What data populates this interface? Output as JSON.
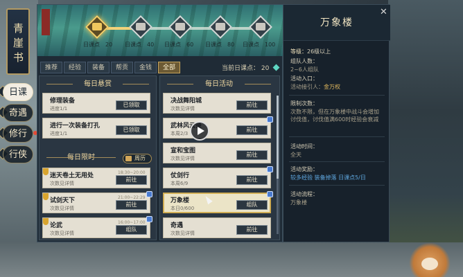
{
  "sidebar": {
    "book_title": "青崖书",
    "tabs": [
      {
        "label": "日课",
        "active": true
      },
      {
        "label": "奇遇",
        "active": false
      },
      {
        "label": "修行",
        "active": false,
        "red_dot": true
      },
      {
        "label": "行侠",
        "active": false
      }
    ]
  },
  "banner": {
    "progress": 0.2,
    "milestones": [
      {
        "label": "日课点",
        "value": "20"
      },
      {
        "label": "日课点",
        "value": "40"
      },
      {
        "label": "日课点",
        "value": "60"
      },
      {
        "label": "日课点",
        "value": "80"
      },
      {
        "label": "日课点",
        "value": "100"
      }
    ]
  },
  "tabs": [
    "推荐",
    "经验",
    "装备",
    "帮贡",
    "金钱",
    "全部"
  ],
  "active_tab": "全部",
  "today_points": {
    "label": "当前日课点：",
    "value": "20"
  },
  "sections": {
    "daily_bounty": "每日悬赏",
    "daily_activity": "每日活动",
    "daily_limited": "每日限时",
    "calendar_button": "周历"
  },
  "bounty_cards": [
    {
      "title": "修理装备",
      "sub": "进度1/1",
      "button": "已领取"
    },
    {
      "title": "进行一次装备打孔",
      "sub": "进度1/1",
      "button": "已领取"
    }
  ],
  "limited_cards": [
    {
      "title": "迷天卷土无用处",
      "sub": "次数见详情",
      "time": "18:30~20:00",
      "button": "前往"
    },
    {
      "title": "试剑天下",
      "sub": "次数见详情",
      "time": "21:00~22:29",
      "button": "前往"
    },
    {
      "title": "论武",
      "sub": "次数见详情",
      "time": "16:00~17:00",
      "button": "组队"
    }
  ],
  "activity_cards": [
    {
      "title": "决战舞阳城",
      "sub": "次数见详情",
      "button": "前往"
    },
    {
      "title": "武林风云录",
      "sub": "本周2/3",
      "button": "前往"
    },
    {
      "title": "宣和宝图",
      "sub": "次数见详情",
      "button": "前往"
    },
    {
      "title": "仗剑行",
      "sub": "本周6/9",
      "button": "前往"
    },
    {
      "title": "万象楼",
      "sub": "本日0/600",
      "button": "组队",
      "highlight": true
    },
    {
      "title": "奇遇",
      "sub": "次数见详情",
      "button": "前往"
    }
  ],
  "detail": {
    "title": "万象楼",
    "level_label": "等级：",
    "level_value": "26级以上",
    "party_label": "组队人数：",
    "party_value": "2~6人组队",
    "entry_label": "活动入口：",
    "entry_value": "活动接引人：",
    "entry_link": "金万权",
    "limit_label": "限制次数：",
    "limit_text": "次数不限，但在万象楼中战斗会增加讨伐值，讨伐值满600时经验会衰减",
    "time_label": "活动时间：",
    "time_value": "全天",
    "reward_label": "活动奖励：",
    "rewards": [
      "较多经验",
      "装备掉落",
      "日课点5/日"
    ],
    "flow_label": "活动流程：",
    "flow_value": "万象楼"
  },
  "colors": {
    "accent": "#c7a45c",
    "link": "#5fa8e0",
    "panel": "#1f2b36"
  }
}
